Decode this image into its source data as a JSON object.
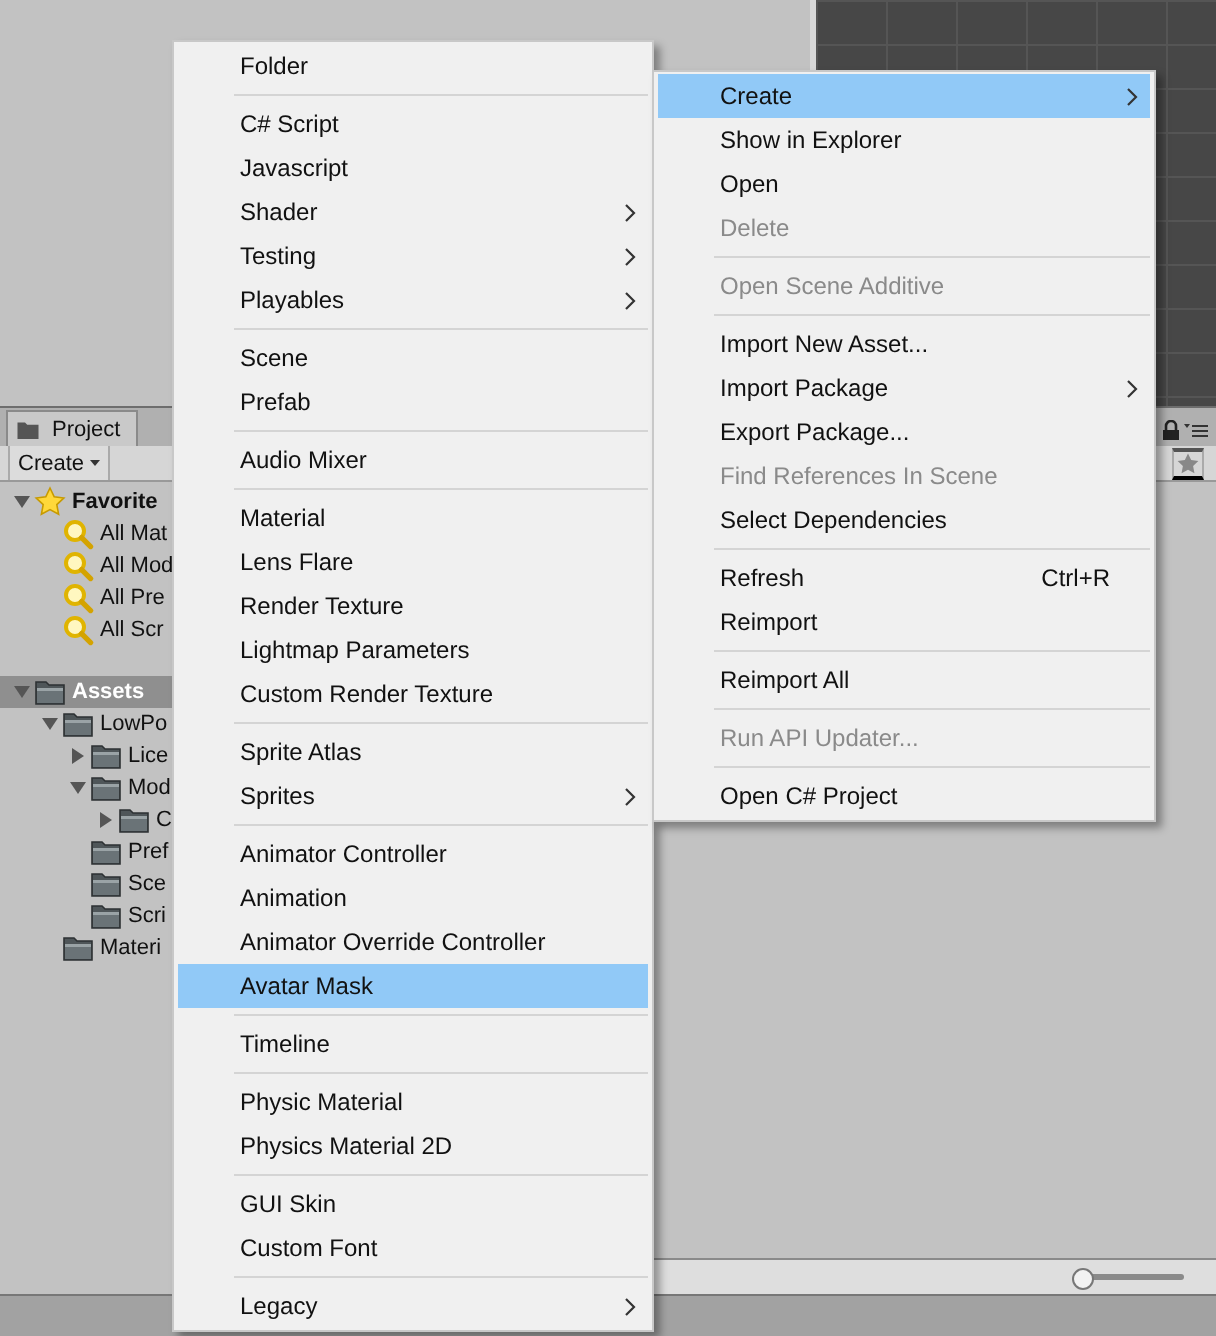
{
  "project_panel": {
    "tab": "Project",
    "create_button": "Create",
    "favorites": {
      "label": "Favorite",
      "kind": "favorites",
      "expanded": true,
      "selected": false,
      "children": [
        {
          "label": "All Mat",
          "kind": "search",
          "selected": false
        },
        {
          "label": "All Mod",
          "kind": "search",
          "selected": false
        },
        {
          "label": "All Pre",
          "kind": "search",
          "selected": false
        },
        {
          "label": "All Scr",
          "kind": "search",
          "selected": false
        }
      ]
    },
    "assets": {
      "label": "Assets",
      "kind": "folder",
      "expanded": true,
      "selected": true,
      "children": [
        {
          "label": "LowPo",
          "kind": "folder",
          "expanded": true,
          "selected": false,
          "children": [
            {
              "label": "Lice",
              "kind": "folder",
              "expanded": false,
              "selected": false
            },
            {
              "label": "Mod",
              "kind": "folder",
              "expanded": true,
              "selected": false,
              "children": [
                {
                  "label": "C",
                  "kind": "folder",
                  "expanded": false,
                  "selected": false
                }
              ]
            },
            {
              "label": "Pref",
              "kind": "folder",
              "selected": false
            },
            {
              "label": "Sce",
              "kind": "folder",
              "selected": false
            },
            {
              "label": "Scri",
              "kind": "folder",
              "selected": false
            }
          ]
        },
        {
          "label": "Materi",
          "kind": "folder",
          "selected": false
        }
      ]
    },
    "zoom_slider": {
      "level": 0
    }
  },
  "create_menu": {
    "groups": [
      [
        {
          "label": "Folder",
          "submenu": false,
          "selected": false,
          "disabled": false
        }
      ],
      [
        {
          "label": "C# Script",
          "submenu": false,
          "selected": false,
          "disabled": false
        },
        {
          "label": "Javascript",
          "submenu": false,
          "selected": false,
          "disabled": false
        },
        {
          "label": "Shader",
          "submenu": true,
          "selected": false,
          "disabled": false
        },
        {
          "label": "Testing",
          "submenu": true,
          "selected": false,
          "disabled": false
        },
        {
          "label": "Playables",
          "submenu": true,
          "selected": false,
          "disabled": false
        }
      ],
      [
        {
          "label": "Scene",
          "submenu": false,
          "selected": false,
          "disabled": false
        },
        {
          "label": "Prefab",
          "submenu": false,
          "selected": false,
          "disabled": false
        }
      ],
      [
        {
          "label": "Audio Mixer",
          "submenu": false,
          "selected": false,
          "disabled": false
        }
      ],
      [
        {
          "label": "Material",
          "submenu": false,
          "selected": false,
          "disabled": false
        },
        {
          "label": "Lens Flare",
          "submenu": false,
          "selected": false,
          "disabled": false
        },
        {
          "label": "Render Texture",
          "submenu": false,
          "selected": false,
          "disabled": false
        },
        {
          "label": "Lightmap Parameters",
          "submenu": false,
          "selected": false,
          "disabled": false
        },
        {
          "label": "Custom Render Texture",
          "submenu": false,
          "selected": false,
          "disabled": false
        }
      ],
      [
        {
          "label": "Sprite Atlas",
          "submenu": false,
          "selected": false,
          "disabled": false
        },
        {
          "label": "Sprites",
          "submenu": true,
          "selected": false,
          "disabled": false
        }
      ],
      [
        {
          "label": "Animator Controller",
          "submenu": false,
          "selected": false,
          "disabled": false
        },
        {
          "label": "Animation",
          "submenu": false,
          "selected": false,
          "disabled": false
        },
        {
          "label": "Animator Override Controller",
          "submenu": false,
          "selected": false,
          "disabled": false
        },
        {
          "label": "Avatar Mask",
          "submenu": false,
          "selected": true,
          "disabled": false
        }
      ],
      [
        {
          "label": "Timeline",
          "submenu": false,
          "selected": false,
          "disabled": false
        }
      ],
      [
        {
          "label": "Physic Material",
          "submenu": false,
          "selected": false,
          "disabled": false
        },
        {
          "label": "Physics Material 2D",
          "submenu": false,
          "selected": false,
          "disabled": false
        }
      ],
      [
        {
          "label": "GUI Skin",
          "submenu": false,
          "selected": false,
          "disabled": false
        },
        {
          "label": "Custom Font",
          "submenu": false,
          "selected": false,
          "disabled": false
        }
      ],
      [
        {
          "label": "Legacy",
          "submenu": true,
          "selected": false,
          "disabled": false
        }
      ]
    ]
  },
  "context_menu": {
    "groups": [
      [
        {
          "label": "Create",
          "submenu": true,
          "selected": true,
          "disabled": false
        },
        {
          "label": "Show in Explorer",
          "submenu": false,
          "selected": false,
          "disabled": false
        },
        {
          "label": "Open",
          "submenu": false,
          "selected": false,
          "disabled": false
        },
        {
          "label": "Delete",
          "submenu": false,
          "selected": false,
          "disabled": true
        }
      ],
      [
        {
          "label": "Open Scene Additive",
          "submenu": false,
          "selected": false,
          "disabled": true
        }
      ],
      [
        {
          "label": "Import New Asset...",
          "submenu": false,
          "selected": false,
          "disabled": false
        },
        {
          "label": "Import Package",
          "submenu": true,
          "selected": false,
          "disabled": false
        },
        {
          "label": "Export Package...",
          "submenu": false,
          "selected": false,
          "disabled": false
        },
        {
          "label": "Find References In Scene",
          "submenu": false,
          "selected": false,
          "disabled": true
        },
        {
          "label": "Select Dependencies",
          "submenu": false,
          "selected": false,
          "disabled": false
        }
      ],
      [
        {
          "label": "Refresh",
          "shortcut": "Ctrl+R",
          "submenu": false,
          "selected": false,
          "disabled": false
        },
        {
          "label": "Reimport",
          "submenu": false,
          "selected": false,
          "disabled": false
        }
      ],
      [
        {
          "label": "Reimport All",
          "submenu": false,
          "selected": false,
          "disabled": false
        }
      ],
      [
        {
          "label": "Run API Updater...",
          "submenu": false,
          "selected": false,
          "disabled": true
        }
      ],
      [
        {
          "label": "Open C# Project",
          "submenu": false,
          "selected": false,
          "disabled": false
        }
      ]
    ]
  }
}
